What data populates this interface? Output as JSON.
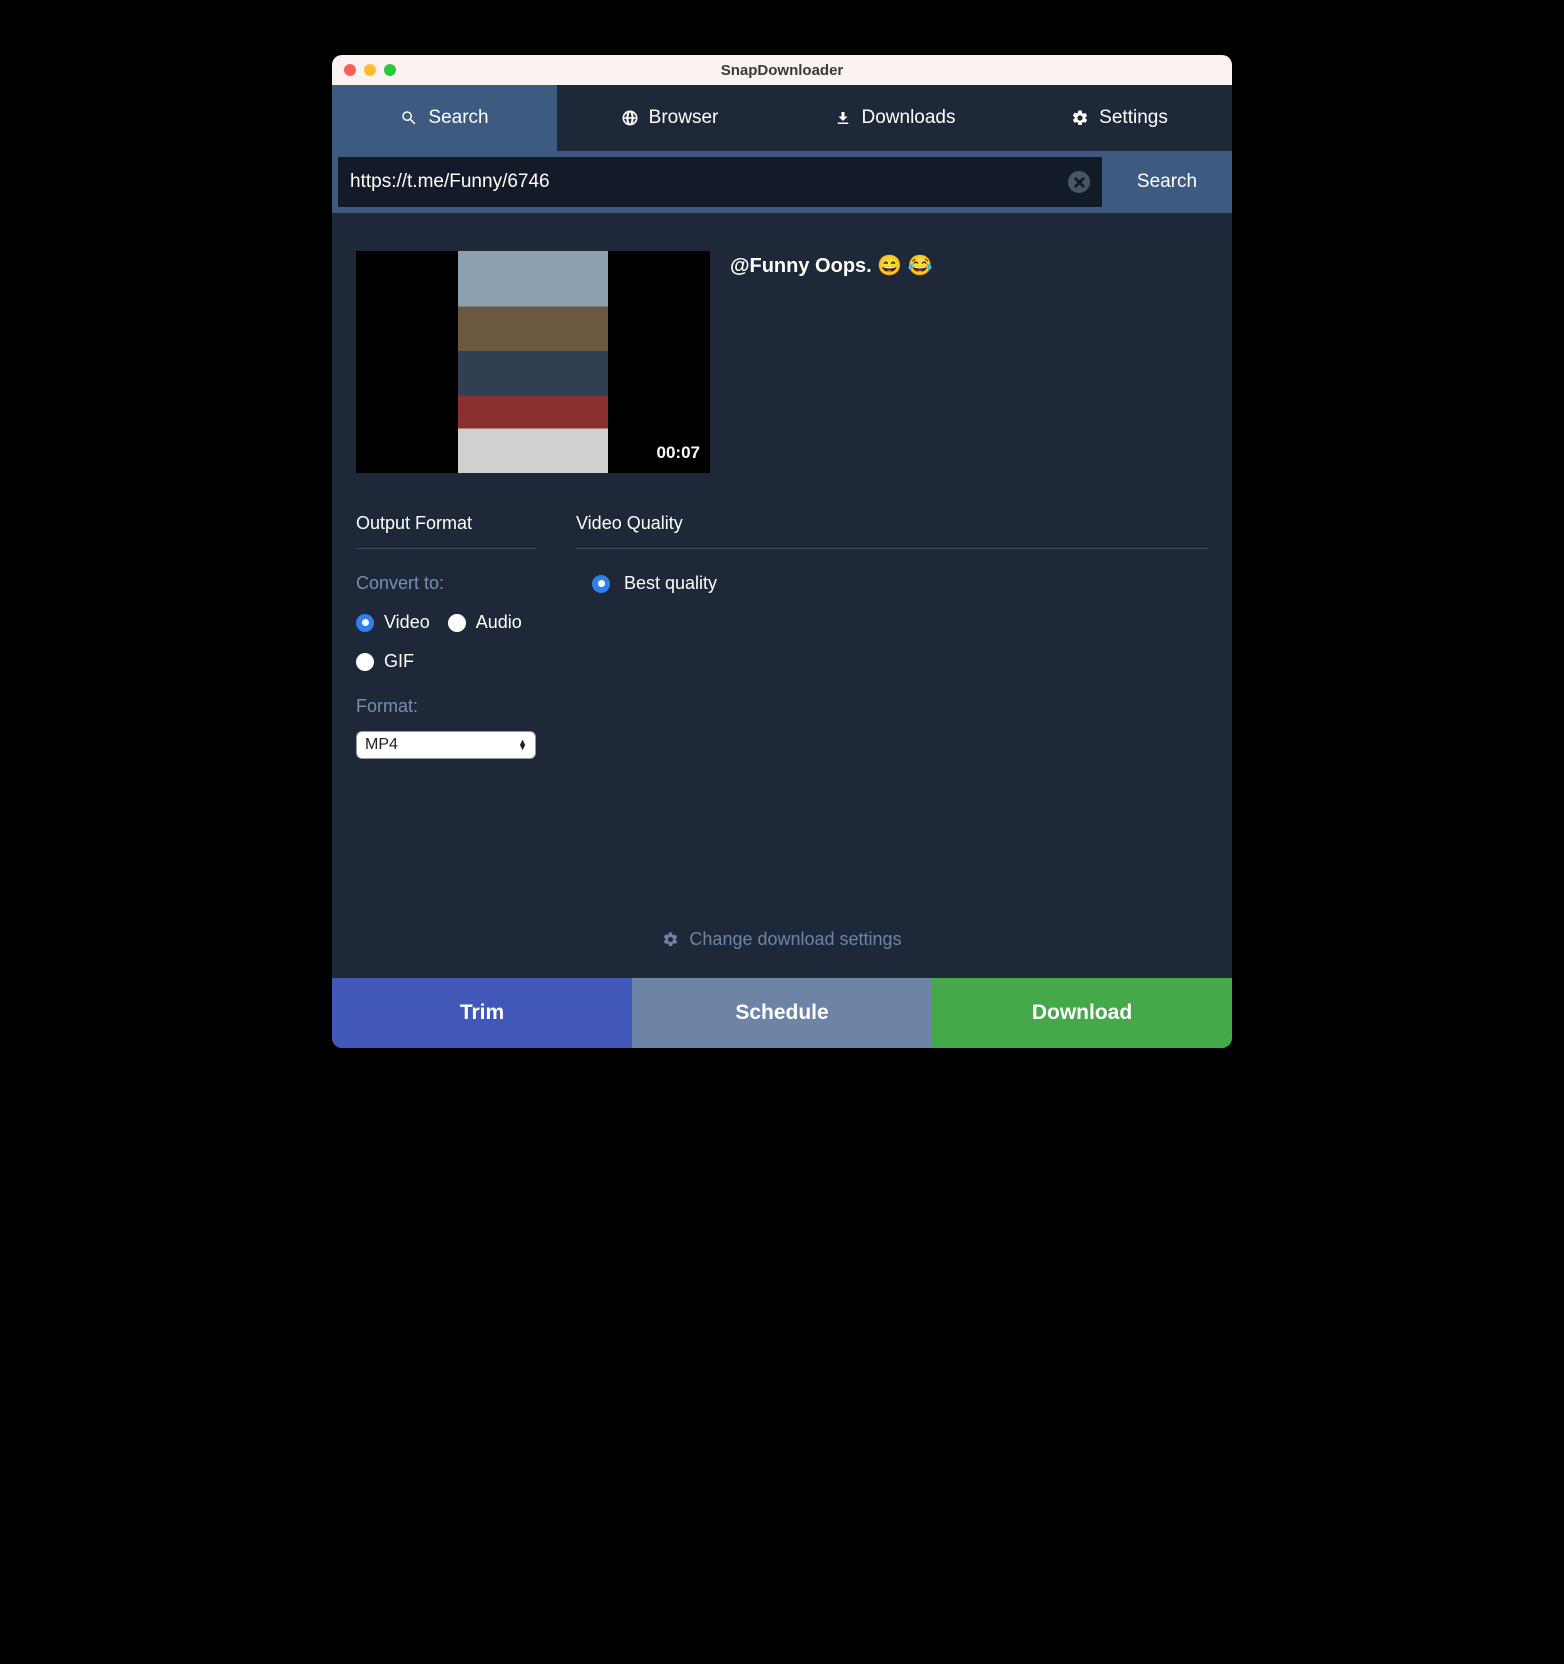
{
  "window": {
    "title": "SnapDownloader"
  },
  "tabs": {
    "search": "Search",
    "browser": "Browser",
    "downloads": "Downloads",
    "settings": "Settings"
  },
  "searchbar": {
    "value": "https://t.me/Funny/6746",
    "button": "Search"
  },
  "result": {
    "title": "@Funny Oops. 😄 😂",
    "duration": "00:07"
  },
  "output": {
    "header": "Output Format",
    "convert_label": "Convert to:",
    "opt_video": "Video",
    "opt_audio": "Audio",
    "opt_gif": "GIF",
    "format_label": "Format:",
    "format_value": "MP4"
  },
  "quality": {
    "header": "Video Quality",
    "best": "Best quality"
  },
  "change_settings": "Change download settings",
  "footer": {
    "trim": "Trim",
    "schedule": "Schedule",
    "download": "Download"
  }
}
